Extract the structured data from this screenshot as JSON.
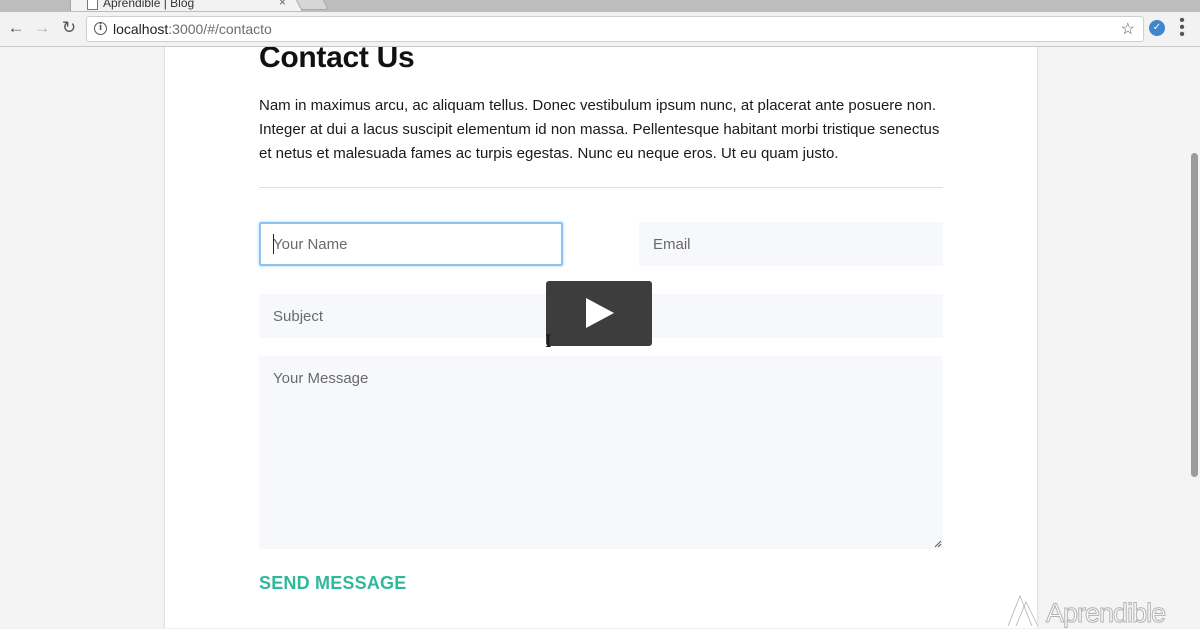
{
  "browser": {
    "tab_title": "Aprendible | Blog",
    "tab_close": "×",
    "url_host": "localhost",
    "url_path": ":3000/#/contacto",
    "back_icon": "←",
    "forward_icon": "→",
    "reload_icon": "↻",
    "star_icon": "☆",
    "info_icon": "i",
    "extension_icon": "✓"
  },
  "page": {
    "title": "Contact Us",
    "intro": "Nam in maximus arcu, ac aliquam tellus. Donec vestibulum ipsum nunc, at placerat ante posuere non. Integer at dui a lacus suscipit elementum id non massa. Pellentesque habitant morbi tristique senectus et netus et malesuada fames ac turpis egestas. Nunc eu neque eros. Ut eu quam justo."
  },
  "form": {
    "name_placeholder": "Your Name",
    "email_placeholder": "Email",
    "subject_placeholder": "Subject",
    "message_placeholder": "Your Message",
    "send_label": "SEND MESSAGE"
  },
  "overlay": {
    "watermark": "Aprendible"
  },
  "colors": {
    "accent": "#2fb89b",
    "focus_border": "#8fc2ef",
    "field_bg": "#f7f8fb"
  }
}
